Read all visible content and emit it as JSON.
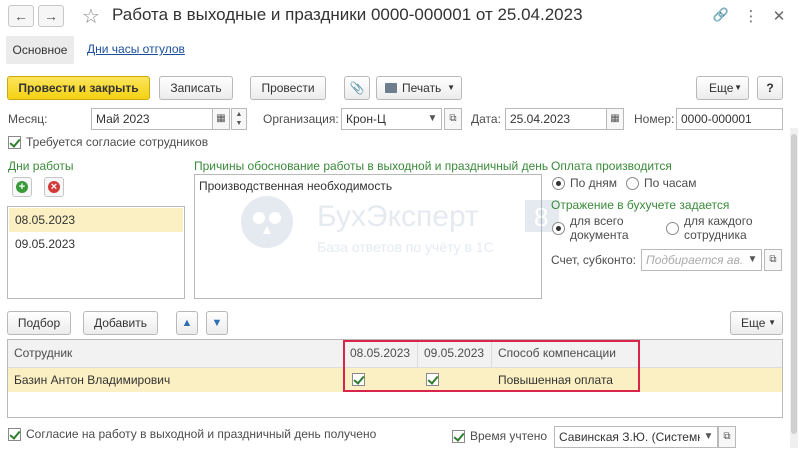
{
  "window": {
    "title": "Работа в выходные и праздники 0000-000001 от 25.04.2023",
    "back_icon": "←",
    "forward_icon": "→",
    "star_icon": "☆",
    "link_icon": "🔗",
    "menu_icon": "⋮",
    "close_icon": "✕"
  },
  "tabs": {
    "main": "Основное",
    "secondary": "Дни часы отгулов"
  },
  "toolbar": {
    "post_close": "Провести и закрыть",
    "save": "Записать",
    "post": "Провести",
    "attach_icon": "📎",
    "print": "Печать",
    "more": "Еще",
    "help": "?"
  },
  "header_fields": {
    "month_label": "Месяц:",
    "month_value": "Май 2023",
    "org_label": "Организация:",
    "org_value": "Крон-Ц",
    "date_label": "Дата:",
    "date_value": "25.04.2023",
    "number_label": "Номер:",
    "number_value": "0000-000001"
  },
  "consent_required": "Требуется согласие сотрудников",
  "work_days": {
    "title": "Дни работы",
    "items": [
      "08.05.2023",
      "09.05.2023"
    ]
  },
  "reasons": {
    "title": "Причины обоснование работы в выходной и праздничный день",
    "text": "Производственная необходимость"
  },
  "payment": {
    "title": "Оплата производится",
    "by_days": "По дням",
    "by_hours": "По часам"
  },
  "accounting": {
    "title": "Отражение в бухучете задается",
    "whole_doc": "для всего документа",
    "each_employee": "для каждого сотрудника",
    "account_label": "Счет, субконто:",
    "account_placeholder": "Подбирается ав..."
  },
  "table_toolbar": {
    "select": "Подбор",
    "add": "Добавить",
    "more": "Еще"
  },
  "table": {
    "columns": [
      "Сотрудник",
      "08.05.2023",
      "09.05.2023",
      "Способ компенсации"
    ],
    "rows": [
      {
        "employee": "Базин Антон Владимирович",
        "d1": true,
        "d2": true,
        "compensation": "Повышенная оплата"
      }
    ]
  },
  "footer": {
    "consent_received": "Согласие на работу в выходной и праздничный день получено",
    "time_accounted": "Время учтено",
    "responsible": "Савинская З.Ю. (Системн"
  },
  "watermark": {
    "brand": "БухЭксперт",
    "digit": "8",
    "tagline": "База ответов по учёту в 1С"
  },
  "colors": {
    "primary": "#f5d213",
    "green_label": "#3a8a3a",
    "selected_row": "#fbf0c3",
    "highlight": "#d9254c"
  }
}
